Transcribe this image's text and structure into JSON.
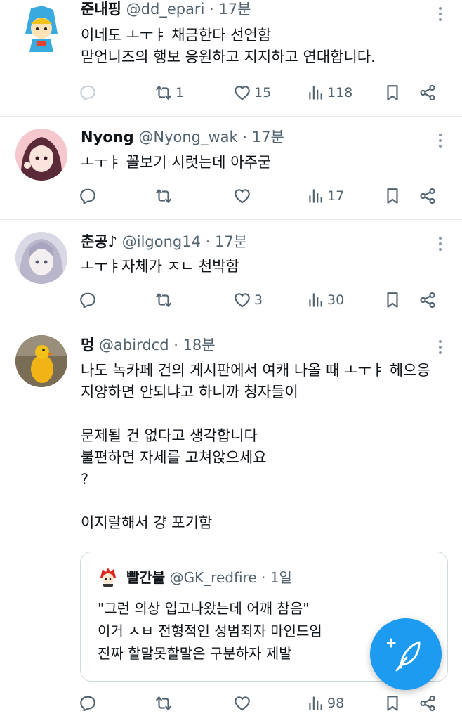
{
  "tweets": [
    {
      "name": "준내핑",
      "handle": "@dd_epari",
      "time": "· 17분",
      "text": "이네도 ㅗㅜㅑ 채금한다 선언함\n맏언니즈의 행보 응원하고 지지하고 연대합니다.",
      "replies": "",
      "retweets": "1",
      "likes": "15",
      "views": "118"
    },
    {
      "name": "Nyong",
      "handle": "@Nyong_wak",
      "time": "· 17분",
      "text": "ㅗㅜㅑ 꼴보기 시럿는데 아주굳",
      "replies": "",
      "retweets": "",
      "likes": "",
      "views": "17"
    },
    {
      "name": "춘공♪",
      "handle": "@ilgong14",
      "time": "· 17분",
      "text": "ㅗㅜㅑ자체가 ㅈㄴ 천박함",
      "replies": "",
      "retweets": "",
      "likes": "3",
      "views": "30"
    },
    {
      "name": "멍",
      "handle": "@abirdcd",
      "time": "· 18분",
      "text": "나도 녹카페 건의 게시판에서 여캐 나올 때 ㅗㅜㅑ 헤으응\n지양하면 안되냐고 하니까 청자들이\n\n문제될 건 없다고 생각합니다\n불편하면 자세를 고쳐앉으세요\n?\n\n이지랄해서 걍 포기함",
      "replies": "",
      "retweets": "",
      "likes": "",
      "views": "98"
    }
  ],
  "quote": {
    "name": "빨간불",
    "handle": "@GK_redfire",
    "time": "· 1일",
    "text": "\"그런 의상 입고나왔는데 어깨 참음\"\n이거 ㅅㅂ 전형적인 성범죄자 마인드임\n진짜 할말못할말은 구분하자 제발"
  },
  "colors": {
    "accent": "#1d9bf0",
    "secondary_text": "#536471",
    "divider": "#e6ecf0"
  },
  "icons": [
    "reply-icon",
    "retweet-icon",
    "like-icon",
    "views-icon",
    "bookmark-icon",
    "share-icon",
    "more-icon",
    "compose-icon"
  ]
}
